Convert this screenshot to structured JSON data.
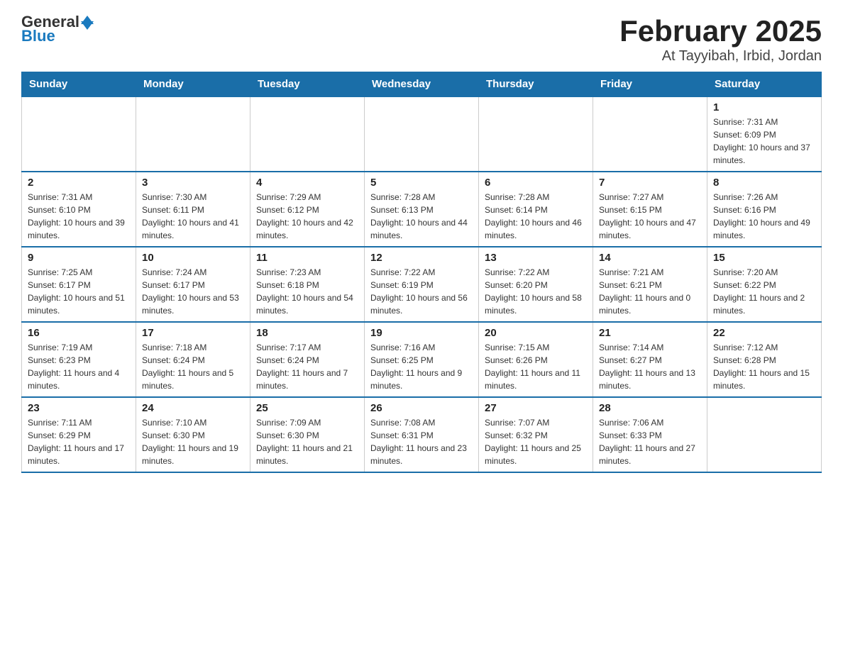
{
  "header": {
    "logo_general": "General",
    "logo_blue": "Blue",
    "title": "February 2025",
    "subtitle": "At Tayyibah, Irbid, Jordan"
  },
  "weekdays": [
    "Sunday",
    "Monday",
    "Tuesday",
    "Wednesday",
    "Thursday",
    "Friday",
    "Saturday"
  ],
  "weeks": [
    [
      {
        "day": "",
        "sunrise": "",
        "sunset": "",
        "daylight": ""
      },
      {
        "day": "",
        "sunrise": "",
        "sunset": "",
        "daylight": ""
      },
      {
        "day": "",
        "sunrise": "",
        "sunset": "",
        "daylight": ""
      },
      {
        "day": "",
        "sunrise": "",
        "sunset": "",
        "daylight": ""
      },
      {
        "day": "",
        "sunrise": "",
        "sunset": "",
        "daylight": ""
      },
      {
        "day": "",
        "sunrise": "",
        "sunset": "",
        "daylight": ""
      },
      {
        "day": "1",
        "sunrise": "Sunrise: 7:31 AM",
        "sunset": "Sunset: 6:09 PM",
        "daylight": "Daylight: 10 hours and 37 minutes."
      }
    ],
    [
      {
        "day": "2",
        "sunrise": "Sunrise: 7:31 AM",
        "sunset": "Sunset: 6:10 PM",
        "daylight": "Daylight: 10 hours and 39 minutes."
      },
      {
        "day": "3",
        "sunrise": "Sunrise: 7:30 AM",
        "sunset": "Sunset: 6:11 PM",
        "daylight": "Daylight: 10 hours and 41 minutes."
      },
      {
        "day": "4",
        "sunrise": "Sunrise: 7:29 AM",
        "sunset": "Sunset: 6:12 PM",
        "daylight": "Daylight: 10 hours and 42 minutes."
      },
      {
        "day": "5",
        "sunrise": "Sunrise: 7:28 AM",
        "sunset": "Sunset: 6:13 PM",
        "daylight": "Daylight: 10 hours and 44 minutes."
      },
      {
        "day": "6",
        "sunrise": "Sunrise: 7:28 AM",
        "sunset": "Sunset: 6:14 PM",
        "daylight": "Daylight: 10 hours and 46 minutes."
      },
      {
        "day": "7",
        "sunrise": "Sunrise: 7:27 AM",
        "sunset": "Sunset: 6:15 PM",
        "daylight": "Daylight: 10 hours and 47 minutes."
      },
      {
        "day": "8",
        "sunrise": "Sunrise: 7:26 AM",
        "sunset": "Sunset: 6:16 PM",
        "daylight": "Daylight: 10 hours and 49 minutes."
      }
    ],
    [
      {
        "day": "9",
        "sunrise": "Sunrise: 7:25 AM",
        "sunset": "Sunset: 6:17 PM",
        "daylight": "Daylight: 10 hours and 51 minutes."
      },
      {
        "day": "10",
        "sunrise": "Sunrise: 7:24 AM",
        "sunset": "Sunset: 6:17 PM",
        "daylight": "Daylight: 10 hours and 53 minutes."
      },
      {
        "day": "11",
        "sunrise": "Sunrise: 7:23 AM",
        "sunset": "Sunset: 6:18 PM",
        "daylight": "Daylight: 10 hours and 54 minutes."
      },
      {
        "day": "12",
        "sunrise": "Sunrise: 7:22 AM",
        "sunset": "Sunset: 6:19 PM",
        "daylight": "Daylight: 10 hours and 56 minutes."
      },
      {
        "day": "13",
        "sunrise": "Sunrise: 7:22 AM",
        "sunset": "Sunset: 6:20 PM",
        "daylight": "Daylight: 10 hours and 58 minutes."
      },
      {
        "day": "14",
        "sunrise": "Sunrise: 7:21 AM",
        "sunset": "Sunset: 6:21 PM",
        "daylight": "Daylight: 11 hours and 0 minutes."
      },
      {
        "day": "15",
        "sunrise": "Sunrise: 7:20 AM",
        "sunset": "Sunset: 6:22 PM",
        "daylight": "Daylight: 11 hours and 2 minutes."
      }
    ],
    [
      {
        "day": "16",
        "sunrise": "Sunrise: 7:19 AM",
        "sunset": "Sunset: 6:23 PM",
        "daylight": "Daylight: 11 hours and 4 minutes."
      },
      {
        "day": "17",
        "sunrise": "Sunrise: 7:18 AM",
        "sunset": "Sunset: 6:24 PM",
        "daylight": "Daylight: 11 hours and 5 minutes."
      },
      {
        "day": "18",
        "sunrise": "Sunrise: 7:17 AM",
        "sunset": "Sunset: 6:24 PM",
        "daylight": "Daylight: 11 hours and 7 minutes."
      },
      {
        "day": "19",
        "sunrise": "Sunrise: 7:16 AM",
        "sunset": "Sunset: 6:25 PM",
        "daylight": "Daylight: 11 hours and 9 minutes."
      },
      {
        "day": "20",
        "sunrise": "Sunrise: 7:15 AM",
        "sunset": "Sunset: 6:26 PM",
        "daylight": "Daylight: 11 hours and 11 minutes."
      },
      {
        "day": "21",
        "sunrise": "Sunrise: 7:14 AM",
        "sunset": "Sunset: 6:27 PM",
        "daylight": "Daylight: 11 hours and 13 minutes."
      },
      {
        "day": "22",
        "sunrise": "Sunrise: 7:12 AM",
        "sunset": "Sunset: 6:28 PM",
        "daylight": "Daylight: 11 hours and 15 minutes."
      }
    ],
    [
      {
        "day": "23",
        "sunrise": "Sunrise: 7:11 AM",
        "sunset": "Sunset: 6:29 PM",
        "daylight": "Daylight: 11 hours and 17 minutes."
      },
      {
        "day": "24",
        "sunrise": "Sunrise: 7:10 AM",
        "sunset": "Sunset: 6:30 PM",
        "daylight": "Daylight: 11 hours and 19 minutes."
      },
      {
        "day": "25",
        "sunrise": "Sunrise: 7:09 AM",
        "sunset": "Sunset: 6:30 PM",
        "daylight": "Daylight: 11 hours and 21 minutes."
      },
      {
        "day": "26",
        "sunrise": "Sunrise: 7:08 AM",
        "sunset": "Sunset: 6:31 PM",
        "daylight": "Daylight: 11 hours and 23 minutes."
      },
      {
        "day": "27",
        "sunrise": "Sunrise: 7:07 AM",
        "sunset": "Sunset: 6:32 PM",
        "daylight": "Daylight: 11 hours and 25 minutes."
      },
      {
        "day": "28",
        "sunrise": "Sunrise: 7:06 AM",
        "sunset": "Sunset: 6:33 PM",
        "daylight": "Daylight: 11 hours and 27 minutes."
      },
      {
        "day": "",
        "sunrise": "",
        "sunset": "",
        "daylight": ""
      }
    ]
  ]
}
